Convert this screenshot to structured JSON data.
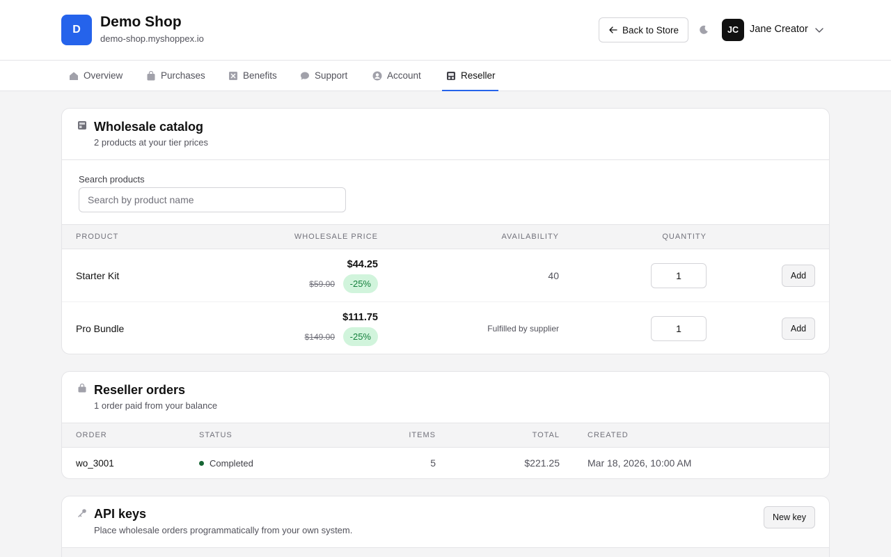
{
  "shop": {
    "logo_letter": "D",
    "name": "Demo Shop",
    "domain": "demo-shop.myshoppex.io"
  },
  "header": {
    "back_label": "Back to Store",
    "user_initials": "JC",
    "user_name": "Jane Creator"
  },
  "nav": {
    "tabs": [
      {
        "label": "Overview",
        "icon": "home-icon"
      },
      {
        "label": "Purchases",
        "icon": "bag-icon"
      },
      {
        "label": "Benefits",
        "icon": "gift-icon"
      },
      {
        "label": "Support",
        "icon": "chat-icon"
      },
      {
        "label": "Account",
        "icon": "user-icon"
      },
      {
        "label": "Reseller",
        "icon": "reseller-icon"
      }
    ],
    "active": "Reseller"
  },
  "catalog": {
    "title": "Wholesale catalog",
    "subtitle": "2 products at your tier prices",
    "search_label": "Search products",
    "search_placeholder": "Search by product name",
    "columns": [
      "PRODUCT",
      "WHOLESALE PRICE",
      "AVAILABILITY",
      "QUANTITY"
    ],
    "products": [
      {
        "name": "Starter Kit",
        "price": "$44.25",
        "original_price": "$59.00",
        "discount": "-25%",
        "availability": "40",
        "quantity": "1",
        "add_label": "Add"
      },
      {
        "name": "Pro Bundle",
        "price": "$111.75",
        "original_price": "$149.00",
        "discount": "-25%",
        "availability": "Fulfilled by supplier",
        "quantity": "1",
        "add_label": "Add"
      }
    ]
  },
  "orders": {
    "title": "Reseller orders",
    "subtitle": "1 order paid from your balance",
    "columns": [
      "ORDER",
      "STATUS",
      "ITEMS",
      "TOTAL",
      "CREATED"
    ],
    "rows": [
      {
        "order": "wo_3001",
        "status": "Completed",
        "items": "5",
        "total": "$221.25",
        "created": "Mar 18, 2026, 10:00 AM"
      }
    ]
  },
  "api_keys": {
    "title": "API keys",
    "subtitle": "Place wholesale orders programmatically from your own system.",
    "new_key_label": "New key"
  },
  "colors": {
    "accent": "#2563eb",
    "discount_bg": "#d1f4dc",
    "discount_text": "#15803d",
    "status_completed": "#166534"
  }
}
